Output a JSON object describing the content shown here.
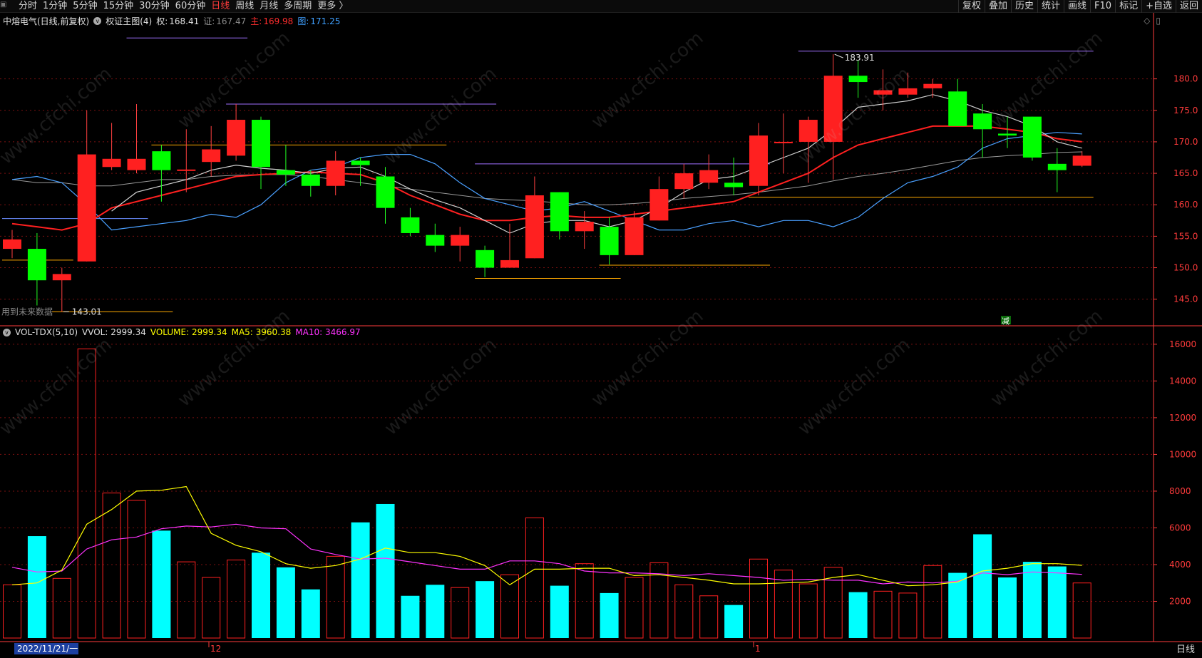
{
  "topbar": {
    "tabs": [
      "分时",
      "1分钟",
      "5分钟",
      "15分钟",
      "30分钟",
      "60分钟",
      "日线",
      "周线",
      "月线",
      "多周期",
      "更多 〉"
    ],
    "active_tab": "日线",
    "tools": [
      "复权",
      "叠加",
      "历史",
      "统计",
      "画线",
      "F10",
      "标记",
      "+自选",
      "返回"
    ]
  },
  "price_header": {
    "stock": "中熔电气(日线,前复权)",
    "indicator": "权证主图(4)",
    "quan_label": "权:",
    "quan_value": "168.41",
    "zheng_label": "证:",
    "zheng_value": "167.47",
    "zhu_label": "主:",
    "zhu_value": "169.98",
    "tu_label": "图:",
    "tu_value": "171.25"
  },
  "volume_header": {
    "indicator": "VOL-TDX(5,10)",
    "vvol": "VVOL: 2999.34",
    "volume": "VOLUME: 2999.34",
    "ma5": "MA5: 3960.38",
    "ma10": "MA10: 3466.97"
  },
  "annotations": {
    "high_label": "183.91",
    "low_label": "143.01",
    "future_data": "用到未来数据",
    "jian_marker": "减"
  },
  "axis_labels": {
    "date_cursor": "2022/11/21/一",
    "month_12": "12",
    "month_1": "1",
    "period_button": "日线"
  },
  "watermark_text": "www.cfchi.com",
  "colors": {
    "up": "#ff2020",
    "down": "#00ff00",
    "vol_down": "#00ffff",
    "ma_white": "#d0d0d0",
    "ma_red": "#ff2020",
    "ma_blue": "#4aa0ff",
    "ma_gray": "#9a9a9a",
    "vol_ma5": "#ffff00",
    "vol_ma10": "#ff33ff",
    "grid": "#7a1010",
    "axis": "#ff3b3b"
  },
  "chart_data": [
    {
      "type": "candlestick",
      "title": "中熔电气(日线,前复权)",
      "y_ticks": [
        145,
        150,
        155,
        160,
        165,
        170,
        175,
        180
      ],
      "ylim": [
        141,
        188
      ],
      "candles": [
        {
          "o": 153.0,
          "c": 154.5,
          "h": 156.0,
          "l": 151.5
        },
        {
          "o": 153.0,
          "c": 148.0,
          "h": 155.5,
          "l": 144.0
        },
        {
          "o": 148.0,
          "c": 149.0,
          "h": 150.0,
          "l": 143.0
        },
        {
          "o": 151.0,
          "c": 168.0,
          "h": 175.0,
          "l": 151.0
        },
        {
          "o": 166.0,
          "c": 167.3,
          "h": 173.0,
          "l": 165.5
        },
        {
          "o": 165.5,
          "c": 167.3,
          "h": 176.0,
          "l": 165.0
        },
        {
          "o": 168.5,
          "c": 165.5,
          "h": 169.5,
          "l": 160.5
        },
        {
          "o": 165.5,
          "c": 165.6,
          "h": 172.0,
          "l": 162.0
        },
        {
          "o": 166.8,
          "c": 168.8,
          "h": 172.5,
          "l": 164.5
        },
        {
          "o": 167.8,
          "c": 173.5,
          "h": 176.0,
          "l": 167.0
        },
        {
          "o": 173.5,
          "c": 166.0,
          "h": 174.0,
          "l": 162.5
        },
        {
          "o": 165.5,
          "c": 164.8,
          "h": 169.5,
          "l": 163.0
        },
        {
          "o": 164.8,
          "c": 163.0,
          "h": 165.5,
          "l": 161.3
        },
        {
          "o": 163.0,
          "c": 167.0,
          "h": 168.5,
          "l": 161.5
        },
        {
          "o": 167.0,
          "c": 166.3,
          "h": 167.5,
          "l": 163.0
        },
        {
          "o": 164.5,
          "c": 159.5,
          "h": 166.0,
          "l": 157.0
        },
        {
          "o": 158.0,
          "c": 155.5,
          "h": 159.5,
          "l": 155.0
        },
        {
          "o": 155.2,
          "c": 153.5,
          "h": 157.0,
          "l": 152.5
        },
        {
          "o": 153.5,
          "c": 155.2,
          "h": 156.5,
          "l": 151.0
        },
        {
          "o": 152.8,
          "c": 150.0,
          "h": 153.5,
          "l": 148.5
        },
        {
          "o": 150.0,
          "c": 151.2,
          "h": 157.0,
          "l": 150.0
        },
        {
          "o": 151.5,
          "c": 161.5,
          "h": 164.5,
          "l": 151.5
        },
        {
          "o": 162.0,
          "c": 155.8,
          "h": 162.0,
          "l": 154.5
        },
        {
          "o": 155.8,
          "c": 157.3,
          "h": 159.0,
          "l": 153.0
        },
        {
          "o": 156.5,
          "c": 152.0,
          "h": 158.0,
          "l": 150.5
        },
        {
          "o": 152.0,
          "c": 158.0,
          "h": 159.0,
          "l": 152.0
        },
        {
          "o": 157.5,
          "c": 162.5,
          "h": 164.5,
          "l": 157.5
        },
        {
          "o": 162.5,
          "c": 165.0,
          "h": 166.5,
          "l": 161.0
        },
        {
          "o": 163.5,
          "c": 165.5,
          "h": 168.0,
          "l": 162.5
        },
        {
          "o": 163.5,
          "c": 162.8,
          "h": 167.5,
          "l": 161.5
        },
        {
          "o": 163.0,
          "c": 171.0,
          "h": 173.0,
          "l": 161.5
        },
        {
          "o": 170.0,
          "c": 170.0,
          "h": 174.5,
          "l": 165.0
        },
        {
          "o": 170.0,
          "c": 173.5,
          "h": 174.0,
          "l": 163.5
        },
        {
          "o": 170.0,
          "c": 180.5,
          "h": 183.91,
          "l": 164.0
        },
        {
          "o": 180.5,
          "c": 179.5,
          "h": 183.0,
          "l": 177.0
        },
        {
          "o": 177.5,
          "c": 178.2,
          "h": 181.5,
          "l": 175.0
        },
        {
          "o": 177.5,
          "c": 178.5,
          "h": 181.0,
          "l": 177.0
        },
        {
          "o": 178.5,
          "c": 179.2,
          "h": 180.0,
          "l": 177.0
        },
        {
          "o": 178.0,
          "c": 172.5,
          "h": 180.0,
          "l": 172.5
        },
        {
          "o": 174.5,
          "c": 172.0,
          "h": 176.0,
          "l": 167.5
        },
        {
          "o": 171.3,
          "c": 171.0,
          "h": 174.0,
          "l": 169.0
        },
        {
          "o": 174.0,
          "c": 167.5,
          "h": 174.0,
          "l": 167.0
        },
        {
          "o": 166.5,
          "c": 165.5,
          "h": 169.0,
          "l": 162.0
        },
        {
          "o": 166.2,
          "c": 167.8,
          "h": 168.5,
          "l": 166.0
        }
      ],
      "ma_white": [
        null,
        null,
        null,
        null,
        159.0,
        162.0,
        163.0,
        164.0,
        165.5,
        166.3,
        165.8,
        165.5,
        165.0,
        165.8,
        166.0,
        164.5,
        162.5,
        160.8,
        159.5,
        157.5,
        155.5,
        157.0,
        157.5,
        157.5,
        156.5,
        157.5,
        159.5,
        162.0,
        164.0,
        164.5,
        166.0,
        167.5,
        169.0,
        172.0,
        175.5,
        176.0,
        176.5,
        177.5,
        176.5,
        175.0,
        174.0,
        172.5,
        170.0,
        169.0
      ],
      "ma_red": [
        157.0,
        156.5,
        156.0,
        157.0,
        159.5,
        160.5,
        161.5,
        162.5,
        163.5,
        164.5,
        164.8,
        165.0,
        165.2,
        165.0,
        164.8,
        163.5,
        161.5,
        160.0,
        158.5,
        157.5,
        157.5,
        158.0,
        158.3,
        158.0,
        158.0,
        158.5,
        159.0,
        159.5,
        160.0,
        160.5,
        162.0,
        163.5,
        165.0,
        167.5,
        169.5,
        170.5,
        171.5,
        172.5,
        172.5,
        172.5,
        172.0,
        171.5,
        170.5,
        170.0
      ],
      "ma_blue": [
        164.0,
        164.5,
        163.5,
        160.0,
        156.0,
        156.5,
        157.0,
        157.5,
        158.5,
        158.0,
        160.0,
        163.5,
        165.5,
        166.0,
        167.5,
        168.0,
        168.0,
        166.5,
        163.5,
        161.0,
        160.0,
        159.0,
        159.5,
        160.5,
        159.0,
        157.5,
        156.0,
        156.0,
        157.0,
        157.5,
        156.5,
        157.5,
        157.5,
        156.5,
        158.0,
        161.0,
        163.5,
        164.5,
        166.0,
        169.0,
        170.5,
        171.0,
        171.5,
        171.25
      ],
      "ma_gray": [
        164.0,
        163.5,
        163.5,
        163.0,
        163.0,
        163.5,
        164.0,
        164.0,
        164.5,
        164.7,
        164.8,
        164.8,
        164.5,
        164.0,
        163.5,
        163.0,
        162.5,
        162.0,
        161.5,
        161.0,
        160.8,
        160.6,
        160.3,
        160.0,
        160.0,
        160.2,
        160.5,
        161.0,
        161.3,
        161.6,
        162.0,
        162.5,
        163.0,
        163.8,
        164.5,
        165.0,
        165.6,
        166.3,
        167.0,
        167.5,
        167.8,
        168.0,
        168.3,
        168.41
      ],
      "ma_white_last": 168.41
    },
    {
      "type": "bar",
      "title": "VOL-TDX(5,10)",
      "y_ticks": [
        2000,
        4000,
        6000,
        8000,
        10000,
        12000,
        14000,
        16000
      ],
      "ylim": [
        0,
        16500
      ],
      "volumes": [
        2900,
        5550,
        3250,
        15750,
        7900,
        7500,
        5850,
        4150,
        3300,
        4250,
        4650,
        3850,
        2650,
        4450,
        6300,
        7300,
        2300,
        2900,
        2750,
        3100,
        3450,
        6550,
        2850,
        4050,
        2450,
        3300,
        4100,
        2900,
        2300,
        1800,
        4300,
        3700,
        2950,
        3850,
        2500,
        2550,
        2450,
        3950,
        3550,
        5650,
        3300,
        4150,
        3900,
        3000
      ],
      "ma5": [
        2900,
        3000,
        3700,
        6200,
        7000,
        8000,
        8050,
        8250,
        5700,
        5050,
        4700,
        4050,
        3800,
        3950,
        4300,
        4900,
        4650,
        4650,
        4450,
        3950,
        2900,
        3750,
        3750,
        3800,
        3800,
        3400,
        3450,
        3300,
        3150,
        2950,
        2950,
        3000,
        3050,
        3300,
        3450,
        3150,
        2850,
        2900,
        3050,
        3650,
        3800,
        4050,
        4050,
        3960.38
      ],
      "ma10": [
        3850,
        3600,
        3650,
        4850,
        5350,
        5500,
        5950,
        6100,
        6050,
        6200,
        6000,
        5950,
        4850,
        4550,
        4300,
        4350,
        4150,
        3950,
        3750,
        3750,
        4200,
        4200,
        4050,
        3650,
        3550,
        3550,
        3500,
        3400,
        3500,
        3400,
        3300,
        3150,
        3200,
        3150,
        3150,
        2950,
        3050,
        3000,
        3100,
        3550,
        3450,
        3600,
        3550,
        3466.97
      ]
    }
  ]
}
